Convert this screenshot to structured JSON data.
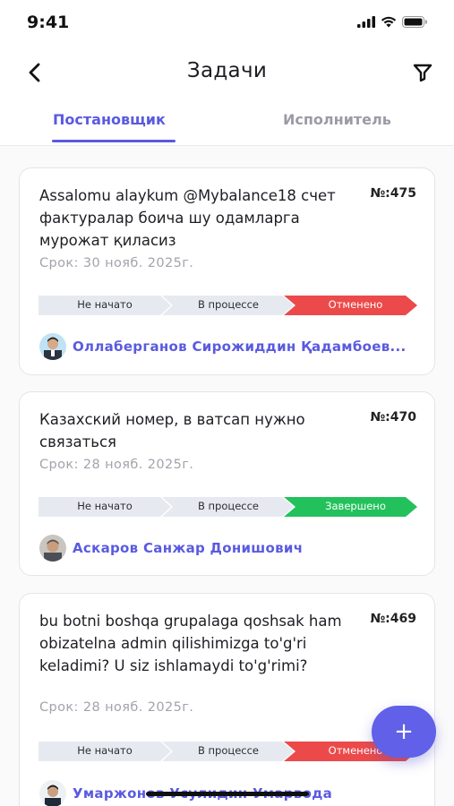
{
  "status_bar": {
    "time": "9:41"
  },
  "header": {
    "title": "Задачи",
    "back_icon": "chevron-left-icon",
    "filter_icon": "filter-icon"
  },
  "tabs": [
    {
      "label": "Постановщик",
      "active": true
    },
    {
      "label": "Исполнитель",
      "active": false
    }
  ],
  "tasks": [
    {
      "title": "Assalomu alaykum @Mybalance18 счет фактуралар боича шу одамларга мурожат қиласиз",
      "number": "№:475",
      "deadline": "Срок: 30 нояб. 2025г.",
      "stages": [
        "Не начато",
        "В процессе",
        "Отменено"
      ],
      "status_color": "#ec4a4a",
      "assignee": "Оллаберганов Сирожиддин Қадамбоев..."
    },
    {
      "title": "Казахский номер, в ватсап нужно связаться",
      "number": "№:470",
      "deadline": "Срок: 28 нояб. 2025г.",
      "stages": [
        "Не начато",
        "В процессе",
        "Завершено"
      ],
      "status_color": "#23c15c",
      "assignee": "Аскаров Санжар Донишович"
    },
    {
      "title": "bu botni boshqa grupalaga qoshsak ham obizatelna admin qilishimizga to'g'ri keladimi? U siz ishlamaydi to'g'rimi?",
      "number": "№:469",
      "deadline": "Срок: 28 нояб. 2025г.",
      "stages": [
        "Не начато",
        "В процессе",
        "Отменено"
      ],
      "status_color": "#ec4a4a",
      "assignee": "Умаржонов Усулидин Умарвода"
    }
  ],
  "fab": {
    "label": "+"
  },
  "colors": {
    "accent": "#5a5ae0",
    "stage_bg": "#e6eaf0",
    "cancelled": "#ec4a4a",
    "done": "#23c15c"
  }
}
